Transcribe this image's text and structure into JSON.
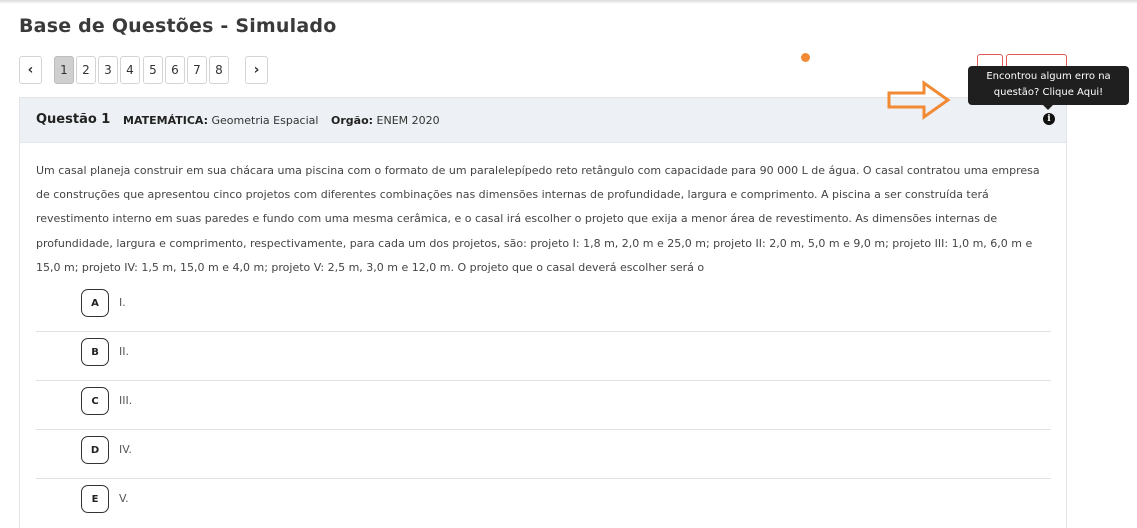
{
  "page": {
    "title": "Base de Questões - Simulado"
  },
  "pagination": {
    "prev_icon": "chevron-left-icon",
    "next_icon": "chevron-right-icon",
    "pages": [
      "1",
      "2",
      "3",
      "4",
      "5",
      "6",
      "7",
      "8"
    ],
    "active_page": "1"
  },
  "tooltip": {
    "line1": "Encontrou algum erro na",
    "line2": "questão? Clique Aqui!"
  },
  "colors": {
    "accent_orange": "#f28a34",
    "red_border": "#e05a5a",
    "header_bg": "#edf0f4",
    "tooltip_bg": "#1f1f1f"
  },
  "question": {
    "number": "Questão 1",
    "subject_label": "MATEMÁTICA:",
    "subject_value": "Geometria Espacial",
    "org_label": "Orgão:",
    "org_value": "ENEM 2020",
    "info_icon": "info-icon",
    "text": "Um casal planeja construir em sua chácara uma piscina com o formato de um paralelepípedo reto retângulo com capacidade para 90 000 L de água. O casal contratou uma empresa de construções que apresentou cinco projetos com diferentes combinações nas dimensões internas de profundidade, largura e comprimento. A piscina a ser construída terá revestimento interno em suas paredes e fundo com uma mesma cerâmica, e o casal irá escolher o projeto que exija a menor área de revestimento. As dimensões internas de profundidade, largura e comprimento, respectivamente, para cada um dos projetos, são: projeto I: 1,8 m, 2,0 m e 25,0 m; projeto II: 2,0 m, 5,0 m e 9,0 m; projeto III: 1,0 m, 6,0 m e 15,0 m; projeto IV: 1,5 m, 15,0 m e 4,0 m; projeto V: 2,5 m, 3,0 m e 12,0 m. O projeto que o casal deverá escolher será o",
    "options": [
      {
        "letter": "A",
        "text": "I."
      },
      {
        "letter": "B",
        "text": "II."
      },
      {
        "letter": "C",
        "text": "III."
      },
      {
        "letter": "D",
        "text": "IV."
      },
      {
        "letter": "E",
        "text": "V."
      }
    ]
  }
}
